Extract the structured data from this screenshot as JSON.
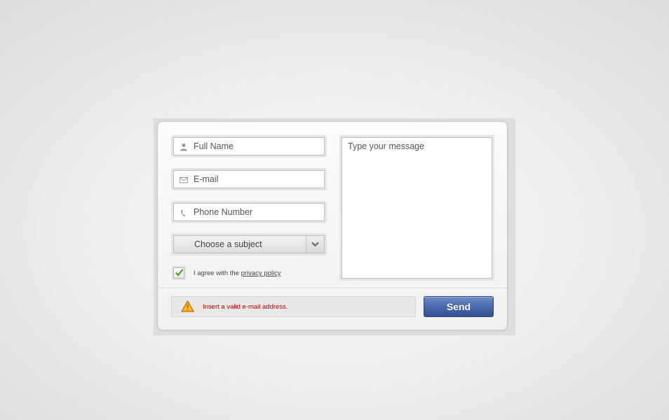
{
  "form": {
    "full_name_placeholder": "Full Name",
    "email_placeholder": "E-mail",
    "phone_placeholder": "Phone Number",
    "subject_selected": "Choose a subject",
    "message_placeholder": "Type your message",
    "agree_text": "I agree with the",
    "privacy_link": "privacy policy",
    "agree_checked": true
  },
  "alert": {
    "text": "Insert a valid e-mail address.",
    "icon": "warning-icon"
  },
  "send_label": "Send",
  "icons": {
    "name_field": "user-icon",
    "email_field": "envelope-icon",
    "phone_field": "phone-icon",
    "select": "chevron-down-icon",
    "checkbox": "checkmark-icon"
  },
  "colors": {
    "accent": "#4a6ab0",
    "error_text": "#b00000",
    "warning_fill": "#f6c21c",
    "check": "#4aa32a"
  }
}
